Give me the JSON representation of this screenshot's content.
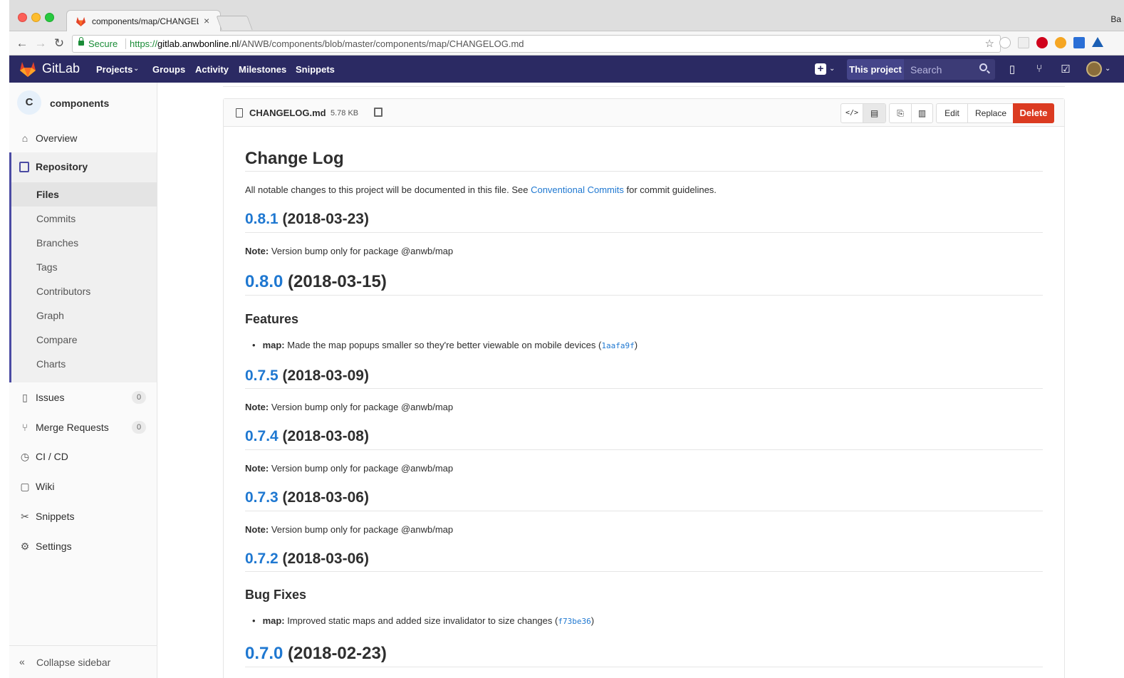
{
  "browser": {
    "tab_title": "components/map/CHANGELOG",
    "profile_label": "Ba",
    "secure_label": "Secure",
    "url_scheme": "https://",
    "url_host": "gitlab.anwbonline.nl",
    "url_path": "/ANWB/components/blob/master/components/map/CHANGELOG.md"
  },
  "navbar": {
    "brand": "GitLab",
    "links": [
      "Projects",
      "Groups",
      "Activity",
      "Milestones",
      "Snippets"
    ],
    "scope_label": "This project",
    "search_placeholder": "Search"
  },
  "sidebar": {
    "project_initial": "C",
    "project_name": "components",
    "overview": "Overview",
    "repository": "Repository",
    "repo_items": [
      "Files",
      "Commits",
      "Branches",
      "Tags",
      "Contributors",
      "Graph",
      "Compare",
      "Charts"
    ],
    "issues": "Issues",
    "issues_count": "0",
    "merge_requests": "Merge Requests",
    "merge_requests_count": "0",
    "cicd": "CI / CD",
    "wiki": "Wiki",
    "snippets": "Snippets",
    "settings": "Settings",
    "collapse": "Collapse sidebar"
  },
  "file": {
    "name": "CHANGELOG.md",
    "size": "5.78 KB",
    "edit": "Edit",
    "replace": "Replace",
    "delete": "Delete"
  },
  "content": {
    "title": "Change Log",
    "intro_before": "All notable changes to this project will be documented in this file. See ",
    "intro_link": "Conventional Commits",
    "intro_after": " for commit guidelines.",
    "note_label": "Note:",
    "note_text": " Version bump only for package @anwb/map",
    "features_heading": "Features",
    "bugfixes_heading": "Bug Fixes",
    "feature_scope": "map:",
    "feature_text": " Made the map popups smaller so they're better viewable on mobile devices (",
    "feature_hash": "1aafa9f",
    "bugfix_scope": "map:",
    "bugfix_text": " Improved static maps and added size invalidator to size changes (",
    "bugfix_hash": "f73be36",
    "close_paren": ")",
    "releases": [
      {
        "version": "0.8.1",
        "date": " (2018-03-23)"
      },
      {
        "version": "0.8.0",
        "date": " (2018-03-15)"
      },
      {
        "version": "0.7.5",
        "date": " (2018-03-09)"
      },
      {
        "version": "0.7.4",
        "date": " (2018-03-08)"
      },
      {
        "version": "0.7.3",
        "date": " (2018-03-06)"
      },
      {
        "version": "0.7.2",
        "date": " (2018-03-06)"
      },
      {
        "version": "0.7.0",
        "date": " (2018-02-23)"
      }
    ]
  },
  "colors": {
    "navbar": "#2b2a63",
    "link": "#1f78d1",
    "delete": "#db3b21",
    "sidebar_accent": "#4b4ba3"
  }
}
